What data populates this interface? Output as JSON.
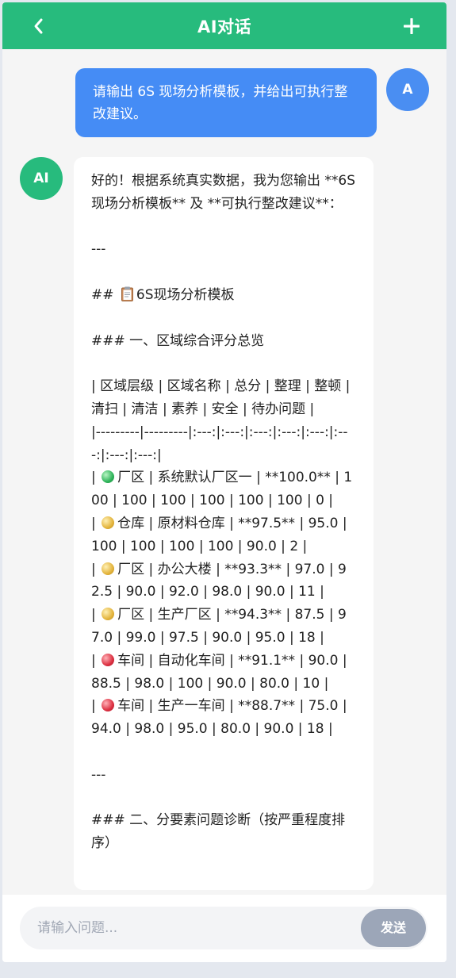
{
  "header": {
    "title": "AI对话",
    "back_icon": "chevron-left-icon",
    "new_icon": "plus-icon",
    "color": "#27bb7d"
  },
  "user": {
    "avatar": "A",
    "message": "请输出 6S 现场分析模板，并给出可执行整改建议。"
  },
  "ai": {
    "avatar": "AI",
    "lines": {
      "l01": "好的！根据系统真实数据，我为您输出 **6S现场分析模板** 及 **可执行整改建议**：",
      "l02": "---",
      "l03_pre": "## ",
      "l03_post": "6S现场分析模板",
      "l04": "### 一、区域综合评分总览",
      "l05": "| 区域层级 | 区域名称 | 总分 | 整理 | 整顿 | 清扫 | 清洁 | 素养 | 安全 | 待办问题 |",
      "l06": "|---------|---------|:---:|:---:|:---:|:---:|:---:|:---:|:---:|:---:|",
      "r1_pre": "| ",
      "r1_post": "厂区 | 系统默认厂区一 | **100.0** | 100 | 100 | 100 | 100 | 100 | 100 | 0 |",
      "r2_pre": "| ",
      "r2_post": "仓库 | 原材料仓库 | **97.5** | 95.0 | 100 | 100 | 100 | 100 | 90.0 | 2 |",
      "r3_pre": "| ",
      "r3_post": "厂区 | 办公大楼 | **93.3** | 97.0 | 92.5 | 90.0 | 92.0 | 98.0 | 90.0 | 11 |",
      "r4_pre": "| ",
      "r4_post": "厂区 | 生产厂区 | **94.3** | 87.5 | 97.0 | 99.0 | 97.5 | 90.0 | 95.0 | 18 |",
      "r5_pre": "| ",
      "r5_post": "车间 | 自动化车间 | **91.1** | 90.0 | 88.5 | 98.0 | 100 | 90.0 | 80.0 | 10 |",
      "r6_pre": "| ",
      "r6_post": "车间 | 生产一车间 | **88.7** | 75.0 | 94.0 | 98.0 | 95.0 | 80.0 | 90.0 | 18 |",
      "l07": "---",
      "l08": "### 二、分要素问题诊断（按严重程度排序）"
    },
    "row_status": [
      "green",
      "yellow",
      "yellow",
      "yellow",
      "red",
      "red"
    ],
    "status_colors": {
      "green": "#2fb45a",
      "yellow": "#e3b43c",
      "red": "#dc3041"
    },
    "heading_icon": "clipboard-icon"
  },
  "composer": {
    "placeholder": "请输入问题...",
    "value": "",
    "send_label": "发送"
  },
  "colors": {
    "user_bubble": "#458cf5",
    "user_avatar": "#4a8ef2",
    "send_button": "#9ca6b8"
  }
}
